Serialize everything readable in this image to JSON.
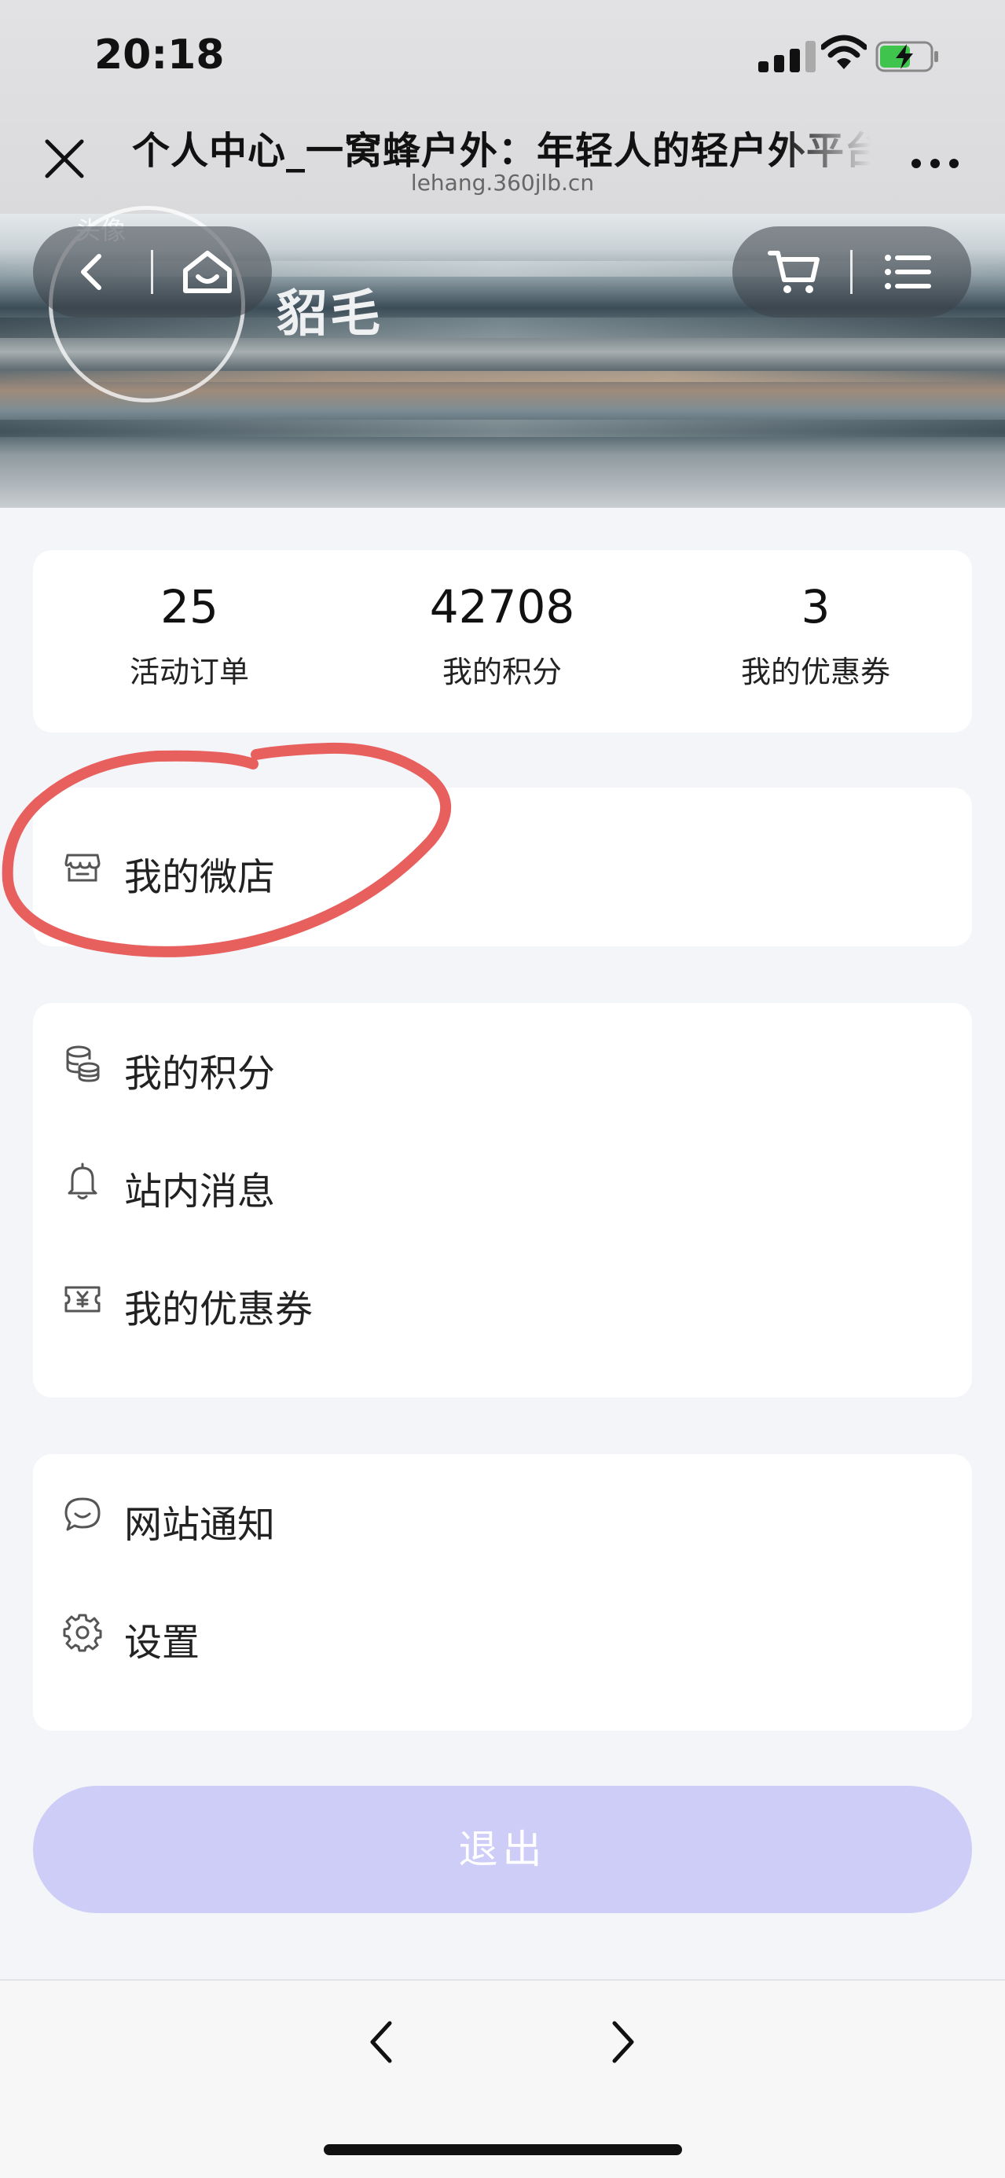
{
  "status_bar": {
    "time": "20:18"
  },
  "browser": {
    "title": "个人中心_一窝蜂户外：年轻人的轻户外平台",
    "url": "lehang.360jlb.cn"
  },
  "profile": {
    "avatar_label": "头像",
    "username": "貂毛"
  },
  "stats": [
    {
      "value": "25",
      "label": "活动订单"
    },
    {
      "value": "42708",
      "label": "我的积分"
    },
    {
      "value": "3",
      "label": "我的优惠券"
    }
  ],
  "menu": {
    "shop": {
      "label": "我的微店",
      "icon": "store-icon"
    },
    "group2": [
      {
        "label": "我的积分",
        "icon": "coins-icon"
      },
      {
        "label": "站内消息",
        "icon": "bell-icon"
      },
      {
        "label": "我的优惠券",
        "icon": "coupon-icon"
      }
    ],
    "group3": [
      {
        "label": "网站通知",
        "icon": "chat-bubble-icon"
      },
      {
        "label": "设置",
        "icon": "gear-icon"
      }
    ]
  },
  "logout": {
    "label": "退出"
  },
  "colors": {
    "accent_disabled": "#cdcdf7",
    "annotation": "#e8605e",
    "background": "#f4f5f9"
  }
}
